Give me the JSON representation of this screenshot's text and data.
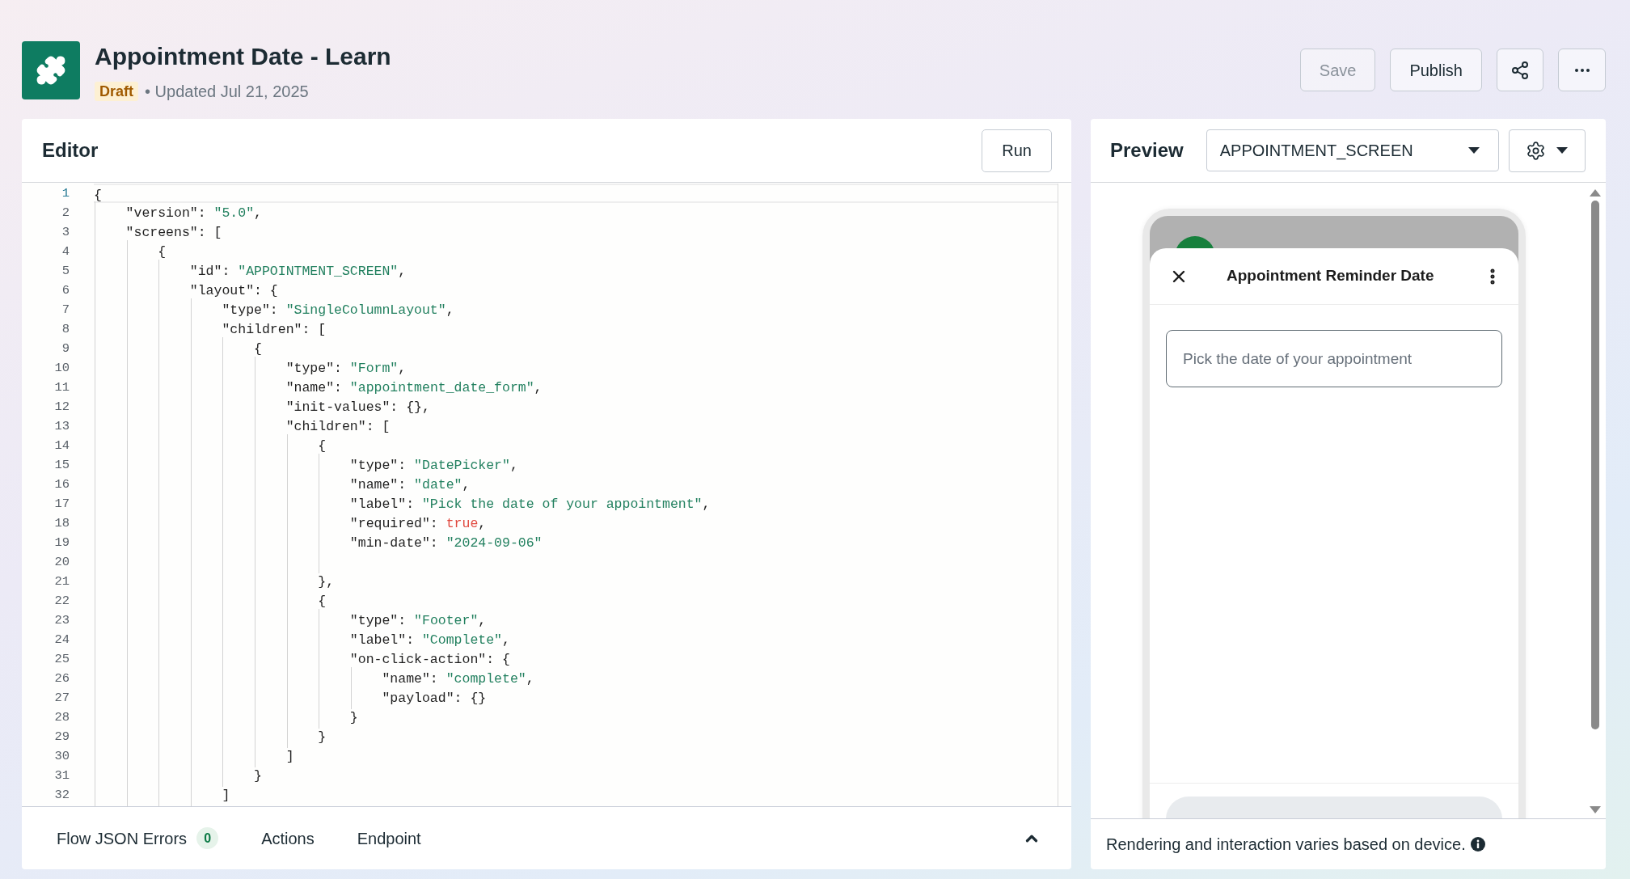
{
  "app": {
    "title": "Appointment Date - Learn",
    "status": "Draft",
    "updated": "• Updated Jul 21, 2025"
  },
  "toolbar": [
    {
      "kind": "text",
      "label": "Save",
      "disabled": true
    },
    {
      "kind": "text",
      "label": "Publish",
      "disabled": false
    },
    {
      "kind": "share"
    },
    {
      "kind": "more"
    }
  ],
  "editor": {
    "title": "Editor",
    "run_button": "Run",
    "lines": [
      {
        "number": "1",
        "current": true,
        "parts": [
          {
            "kind": "plain",
            "text": "{"
          }
        ]
      },
      {
        "number": "2",
        "current": false,
        "parts": [
          {
            "kind": "plain",
            "text": "    \"version\": "
          },
          {
            "kind": "string",
            "text": "\"5.0\""
          },
          {
            "kind": "plain",
            "text": ","
          }
        ]
      },
      {
        "number": "3",
        "current": false,
        "parts": [
          {
            "kind": "plain",
            "text": "    \"screens\": ["
          }
        ]
      },
      {
        "number": "4",
        "current": false,
        "parts": [
          {
            "kind": "plain",
            "text": "        {"
          }
        ]
      },
      {
        "number": "5",
        "current": false,
        "parts": [
          {
            "kind": "plain",
            "text": "            \"id\": "
          },
          {
            "kind": "string",
            "text": "\"APPOINTMENT_SCREEN\""
          },
          {
            "kind": "plain",
            "text": ","
          }
        ]
      },
      {
        "number": "6",
        "current": false,
        "parts": [
          {
            "kind": "plain",
            "text": "            \"layout\": {"
          }
        ]
      },
      {
        "number": "7",
        "current": false,
        "parts": [
          {
            "kind": "plain",
            "text": "                \"type\": "
          },
          {
            "kind": "string",
            "text": "\"SingleColumnLayout\""
          },
          {
            "kind": "plain",
            "text": ","
          }
        ]
      },
      {
        "number": "8",
        "current": false,
        "parts": [
          {
            "kind": "plain",
            "text": "                \"children\": ["
          }
        ]
      },
      {
        "number": "9",
        "current": false,
        "parts": [
          {
            "kind": "plain",
            "text": "                    {"
          }
        ]
      },
      {
        "number": "10",
        "current": false,
        "parts": [
          {
            "kind": "plain",
            "text": "                        \"type\": "
          },
          {
            "kind": "string",
            "text": "\"Form\""
          },
          {
            "kind": "plain",
            "text": ","
          }
        ]
      },
      {
        "number": "11",
        "current": false,
        "parts": [
          {
            "kind": "plain",
            "text": "                        \"name\": "
          },
          {
            "kind": "string",
            "text": "\"appointment_date_form\""
          },
          {
            "kind": "plain",
            "text": ","
          }
        ]
      },
      {
        "number": "12",
        "current": false,
        "parts": [
          {
            "kind": "plain",
            "text": "                        \"init-values\": {},"
          }
        ]
      },
      {
        "number": "13",
        "current": false,
        "parts": [
          {
            "kind": "plain",
            "text": "                        \"children\": ["
          }
        ]
      },
      {
        "number": "14",
        "current": false,
        "parts": [
          {
            "kind": "plain",
            "text": "                            {"
          }
        ]
      },
      {
        "number": "15",
        "current": false,
        "parts": [
          {
            "kind": "plain",
            "text": "                                \"type\": "
          },
          {
            "kind": "string",
            "text": "\"DatePicker\""
          },
          {
            "kind": "plain",
            "text": ","
          }
        ]
      },
      {
        "number": "16",
        "current": false,
        "parts": [
          {
            "kind": "plain",
            "text": "                                \"name\": "
          },
          {
            "kind": "string",
            "text": "\"date\""
          },
          {
            "kind": "plain",
            "text": ","
          }
        ]
      },
      {
        "number": "17",
        "current": false,
        "parts": [
          {
            "kind": "plain",
            "text": "                                \"label\": "
          },
          {
            "kind": "string",
            "text": "\"Pick the date of your appointment\""
          },
          {
            "kind": "plain",
            "text": ","
          }
        ]
      },
      {
        "number": "18",
        "current": false,
        "parts": [
          {
            "kind": "plain",
            "text": "                                \"required\": "
          },
          {
            "kind": "literal",
            "text": "true"
          },
          {
            "kind": "plain",
            "text": ","
          }
        ]
      },
      {
        "number": "19",
        "current": false,
        "parts": [
          {
            "kind": "plain",
            "text": "                                \"min-date\": "
          },
          {
            "kind": "string",
            "text": "\"2024-09-06\""
          }
        ]
      },
      {
        "number": "20",
        "current": false
      },
      {
        "number": "21",
        "current": false,
        "parts": [
          {
            "kind": "plain",
            "text": "                            },"
          }
        ]
      },
      {
        "number": "22",
        "current": false,
        "parts": [
          {
            "kind": "plain",
            "text": "                            {"
          }
        ]
      },
      {
        "number": "23",
        "current": false,
        "parts": [
          {
            "kind": "plain",
            "text": "                                \"type\": "
          },
          {
            "kind": "string",
            "text": "\"Footer\""
          },
          {
            "kind": "plain",
            "text": ","
          }
        ]
      },
      {
        "number": "24",
        "current": false,
        "parts": [
          {
            "kind": "plain",
            "text": "                                \"label\": "
          },
          {
            "kind": "string",
            "text": "\"Complete\""
          },
          {
            "kind": "plain",
            "text": ","
          }
        ]
      },
      {
        "number": "25",
        "current": false,
        "parts": [
          {
            "kind": "plain",
            "text": "                                \"on-click-action\": {"
          }
        ]
      },
      {
        "number": "26",
        "current": false,
        "parts": [
          {
            "kind": "plain",
            "text": "                                    \"name\": "
          },
          {
            "kind": "string",
            "text": "\"complete\""
          },
          {
            "kind": "plain",
            "text": ","
          }
        ]
      },
      {
        "number": "27",
        "current": false,
        "parts": [
          {
            "kind": "plain",
            "text": "                                    \"payload\": {}"
          }
        ]
      },
      {
        "number": "28",
        "current": false,
        "parts": [
          {
            "kind": "plain",
            "text": "                                }"
          }
        ]
      },
      {
        "number": "29",
        "current": false,
        "parts": [
          {
            "kind": "plain",
            "text": "                            }"
          }
        ]
      },
      {
        "number": "30",
        "current": false,
        "parts": [
          {
            "kind": "plain",
            "text": "                        ]"
          }
        ]
      },
      {
        "number": "31",
        "current": false,
        "parts": [
          {
            "kind": "plain",
            "text": "                    }"
          }
        ]
      },
      {
        "number": "32",
        "current": false,
        "parts": [
          {
            "kind": "plain",
            "text": "                ]"
          }
        ]
      }
    ],
    "bottom_tabs": [
      {
        "label": "Flow JSON Errors",
        "badge": "0"
      },
      {
        "label": "Actions"
      },
      {
        "label": "Endpoint"
      }
    ]
  },
  "preview": {
    "title": "Preview",
    "screen_select": "APPOINTMENT_SCREEN",
    "phone": {
      "title": "Appointment Reminder Date",
      "date_field": {
        "placeholder": "Pick the date of your appointment"
      },
      "footer_button": {
        "disabled": true
      }
    },
    "note": "Rendering and interaction varies based on device."
  }
}
